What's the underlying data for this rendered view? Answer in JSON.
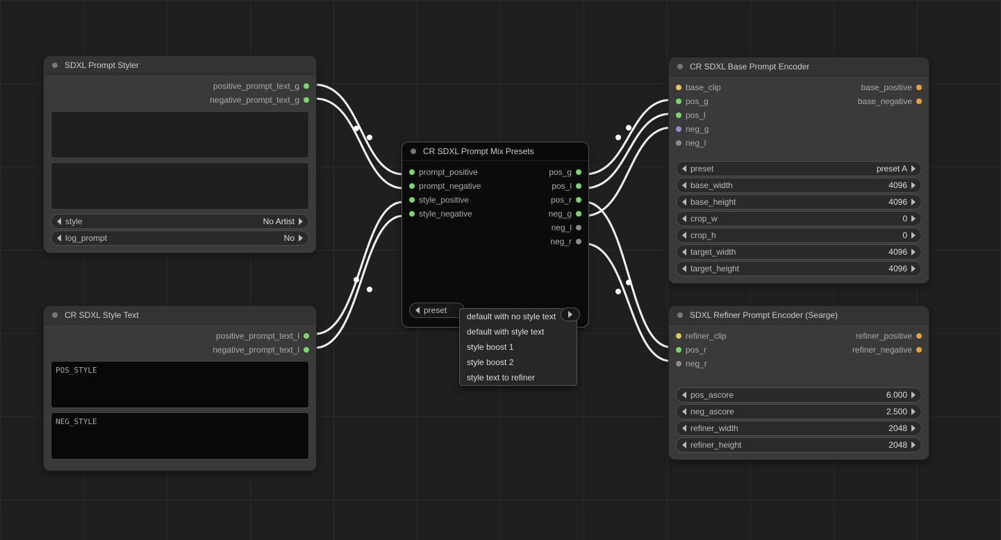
{
  "nodes": {
    "styler": {
      "title": "SDXL Prompt Styler",
      "outputs": [
        {
          "name": "positive_prompt_text_g",
          "color": "green"
        },
        {
          "name": "negative_prompt_text_g",
          "color": "green"
        }
      ],
      "widgets": [
        {
          "label": "style",
          "value": "No Artist"
        },
        {
          "label": "log_prompt",
          "value": "No"
        }
      ]
    },
    "styletext": {
      "title": "CR SDXL Style Text",
      "outputs": [
        {
          "name": "positive_prompt_text_l",
          "color": "green"
        },
        {
          "name": "negative_prompt_text_l",
          "color": "green"
        }
      ],
      "fields": [
        {
          "label": "POS_STYLE"
        },
        {
          "label": "NEG_STYLE"
        }
      ]
    },
    "mix": {
      "title": "CR SDXL Prompt Mix Presets",
      "inputs": [
        {
          "name": "prompt_positive",
          "color": "green"
        },
        {
          "name": "prompt_negative",
          "color": "green"
        },
        {
          "name": "style_positive",
          "color": "green"
        },
        {
          "name": "style_negative",
          "color": "green"
        }
      ],
      "outputs": [
        {
          "name": "pos_g",
          "color": "green"
        },
        {
          "name": "pos_l",
          "color": "green"
        },
        {
          "name": "pos_r",
          "color": "green"
        },
        {
          "name": "neg_g",
          "color": "green"
        },
        {
          "name": "neg_l",
          "color": "gray"
        },
        {
          "name": "neg_r",
          "color": "gray"
        }
      ],
      "preset_label": "preset",
      "preset_options": [
        "default with no style text",
        "default with style text",
        "style boost 1",
        "style boost 2",
        "style text to refiner"
      ]
    },
    "base": {
      "title": "CR SDXL Base Prompt Encoder",
      "inputs": [
        {
          "name": "base_clip",
          "color": "yellow"
        },
        {
          "name": "pos_g",
          "color": "green"
        },
        {
          "name": "pos_l",
          "color": "green"
        },
        {
          "name": "neg_g",
          "color": "purple"
        },
        {
          "name": "neg_l",
          "color": "gray"
        }
      ],
      "outputs": [
        {
          "name": "base_positive",
          "color": "orange"
        },
        {
          "name": "base_negative",
          "color": "orange"
        }
      ],
      "widgets": [
        {
          "label": "preset",
          "value": "preset A"
        },
        {
          "label": "base_width",
          "value": "4096"
        },
        {
          "label": "base_height",
          "value": "4096"
        },
        {
          "label": "crop_w",
          "value": "0"
        },
        {
          "label": "crop_h",
          "value": "0"
        },
        {
          "label": "target_width",
          "value": "4096"
        },
        {
          "label": "target_height",
          "value": "4096"
        }
      ]
    },
    "refiner": {
      "title": "SDXL Refiner Prompt Encoder (Searge)",
      "inputs": [
        {
          "name": "refiner_clip",
          "color": "yellow"
        },
        {
          "name": "pos_r",
          "color": "green"
        },
        {
          "name": "neg_r",
          "color": "gray"
        }
      ],
      "outputs": [
        {
          "name": "refiner_positive",
          "color": "orange"
        },
        {
          "name": "refiner_negative",
          "color": "orange"
        }
      ],
      "widgets": [
        {
          "label": "pos_ascore",
          "value": "6.000"
        },
        {
          "label": "neg_ascore",
          "value": "2.500"
        },
        {
          "label": "refiner_width",
          "value": "2048"
        },
        {
          "label": "refiner_height",
          "value": "2048"
        }
      ]
    }
  }
}
